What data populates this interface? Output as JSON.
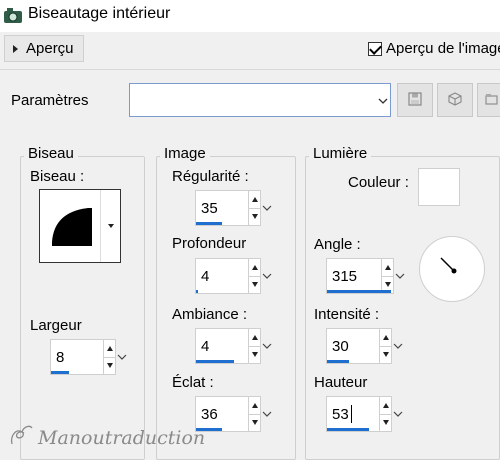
{
  "window": {
    "title": "Biseautage intérieur"
  },
  "preview": {
    "button_label": "Aperçu",
    "checkbox_label": "Aperçu de l'image",
    "checked": true
  },
  "params": {
    "label": "Paramètres",
    "combo_value": ""
  },
  "biseau": {
    "group_label": "Biseau",
    "shape_label": "Biseau :",
    "width_label": "Largeur",
    "width_value": "8"
  },
  "image": {
    "group_label": "Image",
    "regularite_label": "Régularité :",
    "regularite_value": "35",
    "profondeur_label": "Profondeur",
    "profondeur_value": "4",
    "ambiance_label": "Ambiance :",
    "ambiance_value": "4",
    "eclat_label": "Éclat :",
    "eclat_value": "36"
  },
  "lumiere": {
    "group_label": "Lumière",
    "couleur_label": "Couleur :",
    "couleur_value": "#ffffff",
    "angle_label": "Angle :",
    "angle_value": "315",
    "intensite_label": "Intensité :",
    "intensite_value": "30",
    "hauteur_label": "Hauteur",
    "hauteur_value": "53"
  },
  "watermark": {
    "text": "Manoutraduction"
  },
  "colors": {
    "accent": "#1f6fd1",
    "focus_border": "#7a9ccc"
  }
}
